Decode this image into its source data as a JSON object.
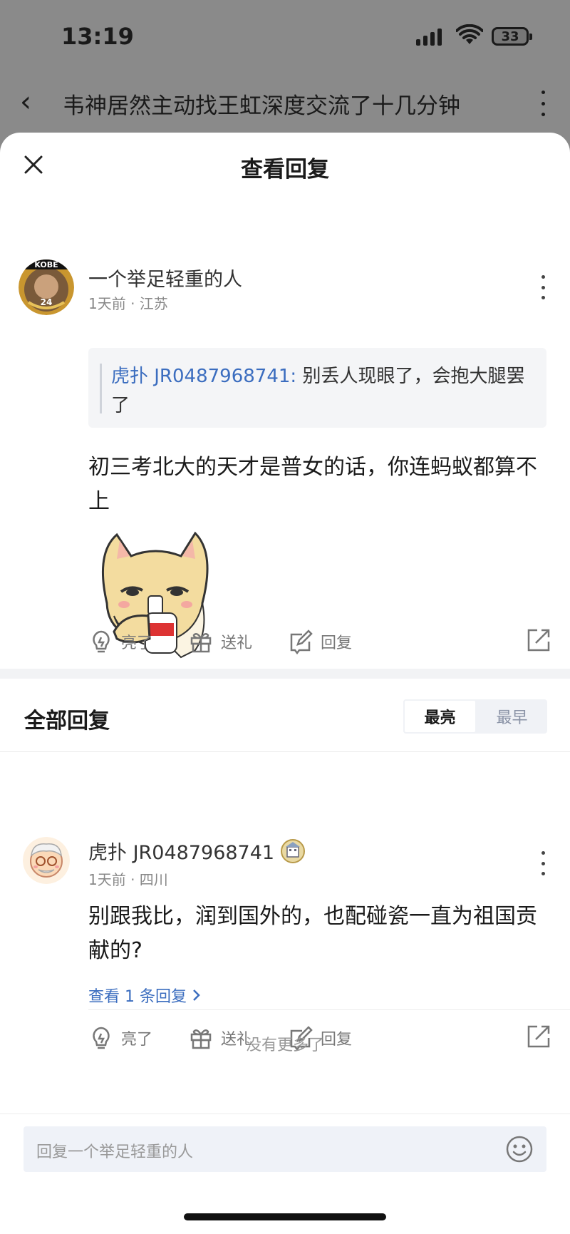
{
  "status_bar": {
    "time": "13:19",
    "battery": "33"
  },
  "background_page": {
    "title": "韦神居然主动找王虹深度交流了十几分钟"
  },
  "sheet": {
    "title": "查看回复"
  },
  "main_comment": {
    "avatar_badge": "KOBE",
    "avatar_number": "24",
    "user": "一个举足轻重的人",
    "meta": "1天前 · 江苏",
    "quote_author": "虎扑 JR0487968741:",
    "quote_text": " 别丢人现眼了，会抱大腿罢了",
    "text": "初三考北大的天才是普女的话，你连蚂蚁都算不上",
    "sticker_icon": "shiba-dog-drinking-sticker",
    "actions": {
      "like": "亮了",
      "gift": "送礼",
      "reply": "回复"
    }
  },
  "replies_section": {
    "title": "全部回复",
    "sort_options": [
      "最亮",
      "最早"
    ],
    "sort_selected": "最亮"
  },
  "reply": {
    "user": "虎扑 JR0487968741",
    "meta": "1天前 · 四川",
    "text": "别跟我比，润到国外的，也配碰瓷一直为祖国贡献的?",
    "view_replies": "查看 1 条回复",
    "actions": {
      "like": "亮了",
      "gift": "送礼",
      "reply": "回复"
    }
  },
  "no_more": "没有更多了",
  "reply_input": {
    "placeholder": "回复一个举足轻重的人"
  },
  "colors": {
    "link": "#3b6dbf",
    "muted": "#777777",
    "sheet_bg": "#ffffff",
    "overlay": "#8a8a8a"
  }
}
